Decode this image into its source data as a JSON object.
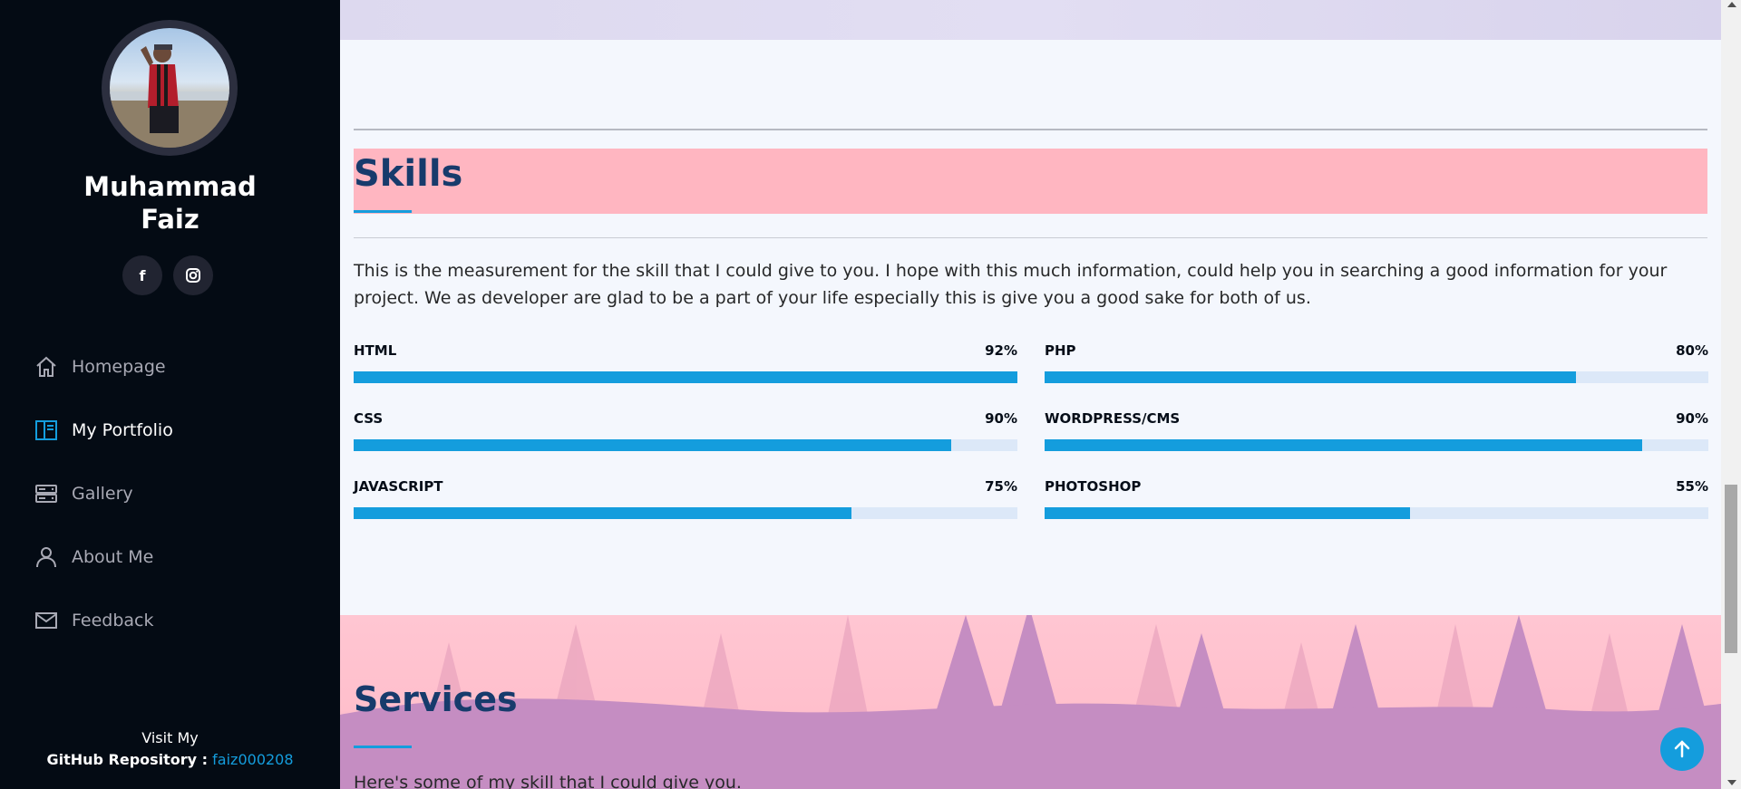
{
  "sidebar": {
    "name_line1": "Muhammad",
    "name_line2": "Faiz",
    "social": [
      {
        "icon": "facebook-icon",
        "glyph": "f"
      },
      {
        "icon": "instagram-icon",
        "glyph": "◎"
      }
    ],
    "nav": [
      {
        "label": "Homepage",
        "icon": "home-icon",
        "active": false
      },
      {
        "label": "My Portfolio",
        "icon": "portfolio-icon",
        "active": true
      },
      {
        "label": "Gallery",
        "icon": "server-icon",
        "active": false
      },
      {
        "label": "About Me",
        "icon": "person-icon",
        "active": false
      },
      {
        "label": "Feedback",
        "icon": "envelope-icon",
        "active": false
      }
    ],
    "footer": {
      "line1": "Visit My",
      "line2_label": "GitHub Repository :",
      "line2_link": "faiz000208"
    }
  },
  "skills": {
    "title": "Skills",
    "description": "This is the measurement for the skill that I could give to you. I hope with this much information, could help you in searching a good information for your project. We as developer are glad to be a part of your life especially this is give you a good sake for both of us.",
    "items": [
      {
        "name": "HTML",
        "value": "92%",
        "percent": 100
      },
      {
        "name": "PHP",
        "value": "80%",
        "percent": 80
      },
      {
        "name": "CSS",
        "value": "90%",
        "percent": 90
      },
      {
        "name": "WORDPRESS/CMS",
        "value": "90%",
        "percent": 90
      },
      {
        "name": "JAVASCRIPT",
        "value": "75%",
        "percent": 75
      },
      {
        "name": "PHOTOSHOP",
        "value": "55%",
        "percent": 55
      }
    ]
  },
  "services": {
    "title": "Services",
    "description": "Here's some of my skill that I could give you."
  },
  "colors": {
    "accent": "#149ddd",
    "sidebar_bg": "#040b14",
    "title_bg": "#ffb6c1",
    "title_text": "#173b6c"
  }
}
